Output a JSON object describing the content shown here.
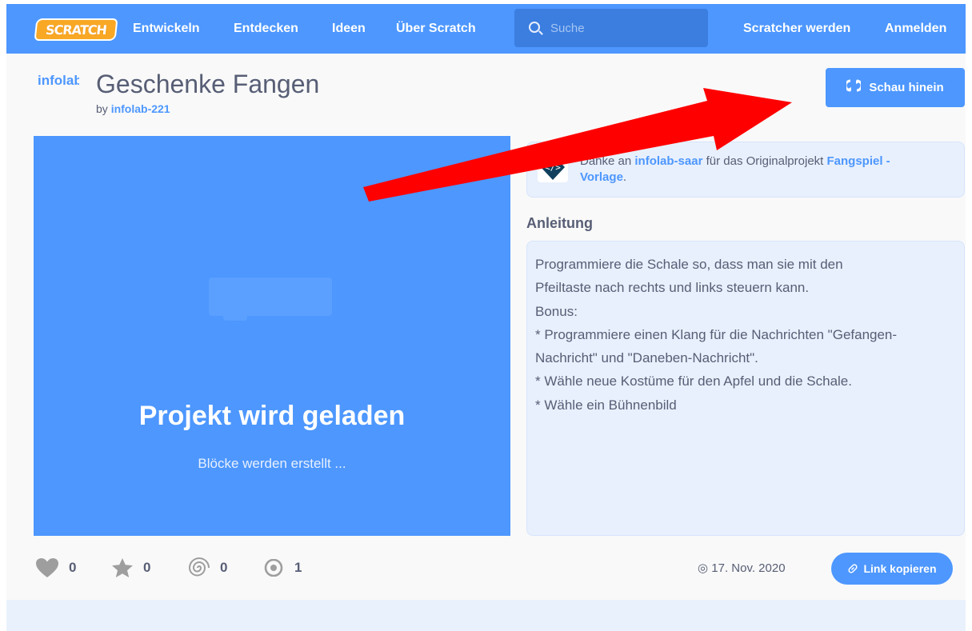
{
  "nav": {
    "logo_text": "SCRATCH",
    "links": [
      "Entwickeln",
      "Entdecken",
      "Ideen",
      "Über Scratch"
    ],
    "search_placeholder": "Suche",
    "join": "Scratcher werden",
    "signin": "Anmelden",
    "bg_color": "#4d97ff"
  },
  "project": {
    "author_thumb": "infolab",
    "title": "Geschenke Fangen",
    "by": "by",
    "author": "infolab-221",
    "see_inside": "Schau hinein",
    "see_inside_icon": "remix-arrows-icon"
  },
  "stage": {
    "loading_title": "Projekt wird geladen",
    "loading_sub": "Blöcke werden erstellt ..."
  },
  "remix_note": {
    "prefix": "Danke an",
    "user": "infolab-saar",
    "middle": "für das Originalprojekt",
    "project_a": "Fangspiel -",
    "project_b": "Vorlage",
    "suffix": "."
  },
  "instructions": {
    "heading": "Anleitung",
    "lines": [
      "Programmiere die Schale so, dass man sie mit den",
      "Pfeiltaste nach rechts und links steuern kann.",
      "Bonus:",
      "* Programmiere einen Klang für die Nachrichten \"Gefangen-",
      "Nachricht\" und \"Daneben-Nachricht\".",
      "* Wähle neue Kostüme für den Apfel und die Schale.",
      "* Wähle ein Bühnenbild"
    ]
  },
  "stats": {
    "loves": "0",
    "favorites": "0",
    "remixes": "0",
    "views": "1",
    "date": "17. Nov. 2020",
    "copy_link": "Link kopieren"
  }
}
